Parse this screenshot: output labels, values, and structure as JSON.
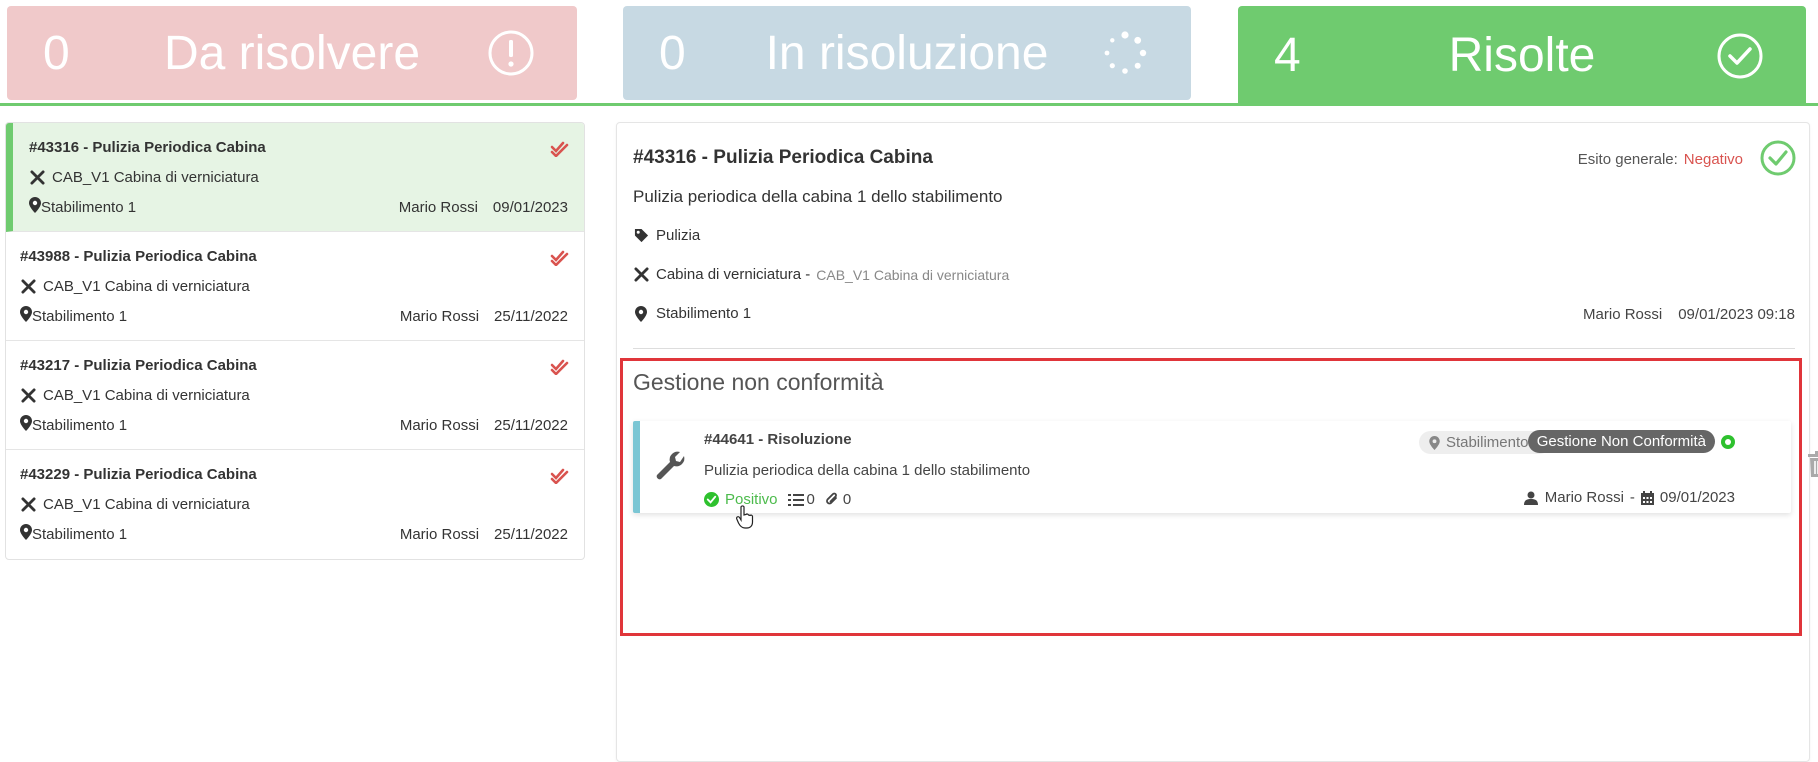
{
  "status_tabs": {
    "todo": {
      "count": "0",
      "label": "Da risolvere"
    },
    "progress": {
      "count": "0",
      "label": "In risoluzione"
    },
    "done": {
      "count": "4",
      "label": "Risolte"
    }
  },
  "colors": {
    "todo": "#f0c9ca",
    "progress": "#c7d9e3",
    "done": "#6fcb6f",
    "negative": "#d9534f",
    "positive": "#4cbb4c",
    "highlight": "#e0353a"
  },
  "list": [
    {
      "title": "#43316 - Pulizia Periodica Cabina",
      "asset": "CAB_V1 Cabina di verniciatura",
      "location": "Stabilimento 1",
      "user": "Mario Rossi",
      "date": "09/01/2023"
    },
    {
      "title": "#43988 - Pulizia Periodica Cabina",
      "asset": "CAB_V1 Cabina di verniciatura",
      "location": "Stabilimento 1",
      "user": "Mario Rossi",
      "date": "25/11/2022"
    },
    {
      "title": "#43217 - Pulizia Periodica Cabina",
      "asset": "CAB_V1 Cabina di verniciatura",
      "location": "Stabilimento 1",
      "user": "Mario Rossi",
      "date": "25/11/2022"
    },
    {
      "title": "#43229 - Pulizia Periodica Cabina",
      "asset": "CAB_V1 Cabina di verniciatura",
      "location": "Stabilimento 1",
      "user": "Mario Rossi",
      "date": "25/11/2022"
    }
  ],
  "detail": {
    "title": "#43316 - Pulizia Periodica Cabina",
    "esito_label": "Esito generale:",
    "esito_value": "Negativo",
    "description": "Pulizia periodica della cabina 1 dello stabilimento",
    "tag": "Pulizia",
    "asset": "Cabina di verniciatura -",
    "asset_sub": "CAB_V1 Cabina di verniciatura",
    "location": "Stabilimento 1",
    "user": "Mario Rossi",
    "datetime": "09/01/2023 09:18"
  },
  "nonconformity": {
    "section_title": "Gestione non conformità",
    "card": {
      "name": "#44641 - Risoluzione",
      "description": "Pulizia periodica della cabina 1 dello stabilimento",
      "status": "Positivo",
      "checklist_count": "0",
      "attachments_count": "0",
      "location_badge": "Stabilimento 1",
      "type_badge": "Gestione Non Conformità",
      "user": "Mario Rossi",
      "separator": "-",
      "date": "09/01/2023"
    }
  }
}
